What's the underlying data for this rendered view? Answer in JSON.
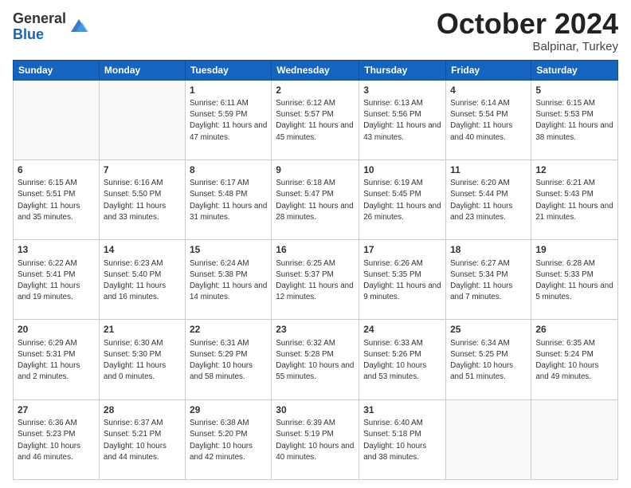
{
  "logo": {
    "general": "General",
    "blue": "Blue"
  },
  "title": {
    "month": "October 2024",
    "location": "Balpinar, Turkey"
  },
  "days_of_week": [
    "Sunday",
    "Monday",
    "Tuesday",
    "Wednesday",
    "Thursday",
    "Friday",
    "Saturday"
  ],
  "weeks": [
    [
      {
        "day": "",
        "info": ""
      },
      {
        "day": "",
        "info": ""
      },
      {
        "day": "1",
        "info": "Sunrise: 6:11 AM\nSunset: 5:59 PM\nDaylight: 11 hours and 47 minutes."
      },
      {
        "day": "2",
        "info": "Sunrise: 6:12 AM\nSunset: 5:57 PM\nDaylight: 11 hours and 45 minutes."
      },
      {
        "day": "3",
        "info": "Sunrise: 6:13 AM\nSunset: 5:56 PM\nDaylight: 11 hours and 43 minutes."
      },
      {
        "day": "4",
        "info": "Sunrise: 6:14 AM\nSunset: 5:54 PM\nDaylight: 11 hours and 40 minutes."
      },
      {
        "day": "5",
        "info": "Sunrise: 6:15 AM\nSunset: 5:53 PM\nDaylight: 11 hours and 38 minutes."
      }
    ],
    [
      {
        "day": "6",
        "info": "Sunrise: 6:15 AM\nSunset: 5:51 PM\nDaylight: 11 hours and 35 minutes."
      },
      {
        "day": "7",
        "info": "Sunrise: 6:16 AM\nSunset: 5:50 PM\nDaylight: 11 hours and 33 minutes."
      },
      {
        "day": "8",
        "info": "Sunrise: 6:17 AM\nSunset: 5:48 PM\nDaylight: 11 hours and 31 minutes."
      },
      {
        "day": "9",
        "info": "Sunrise: 6:18 AM\nSunset: 5:47 PM\nDaylight: 11 hours and 28 minutes."
      },
      {
        "day": "10",
        "info": "Sunrise: 6:19 AM\nSunset: 5:45 PM\nDaylight: 11 hours and 26 minutes."
      },
      {
        "day": "11",
        "info": "Sunrise: 6:20 AM\nSunset: 5:44 PM\nDaylight: 11 hours and 23 minutes."
      },
      {
        "day": "12",
        "info": "Sunrise: 6:21 AM\nSunset: 5:43 PM\nDaylight: 11 hours and 21 minutes."
      }
    ],
    [
      {
        "day": "13",
        "info": "Sunrise: 6:22 AM\nSunset: 5:41 PM\nDaylight: 11 hours and 19 minutes."
      },
      {
        "day": "14",
        "info": "Sunrise: 6:23 AM\nSunset: 5:40 PM\nDaylight: 11 hours and 16 minutes."
      },
      {
        "day": "15",
        "info": "Sunrise: 6:24 AM\nSunset: 5:38 PM\nDaylight: 11 hours and 14 minutes."
      },
      {
        "day": "16",
        "info": "Sunrise: 6:25 AM\nSunset: 5:37 PM\nDaylight: 11 hours and 12 minutes."
      },
      {
        "day": "17",
        "info": "Sunrise: 6:26 AM\nSunset: 5:35 PM\nDaylight: 11 hours and 9 minutes."
      },
      {
        "day": "18",
        "info": "Sunrise: 6:27 AM\nSunset: 5:34 PM\nDaylight: 11 hours and 7 minutes."
      },
      {
        "day": "19",
        "info": "Sunrise: 6:28 AM\nSunset: 5:33 PM\nDaylight: 11 hours and 5 minutes."
      }
    ],
    [
      {
        "day": "20",
        "info": "Sunrise: 6:29 AM\nSunset: 5:31 PM\nDaylight: 11 hours and 2 minutes."
      },
      {
        "day": "21",
        "info": "Sunrise: 6:30 AM\nSunset: 5:30 PM\nDaylight: 11 hours and 0 minutes."
      },
      {
        "day": "22",
        "info": "Sunrise: 6:31 AM\nSunset: 5:29 PM\nDaylight: 10 hours and 58 minutes."
      },
      {
        "day": "23",
        "info": "Sunrise: 6:32 AM\nSunset: 5:28 PM\nDaylight: 10 hours and 55 minutes."
      },
      {
        "day": "24",
        "info": "Sunrise: 6:33 AM\nSunset: 5:26 PM\nDaylight: 10 hours and 53 minutes."
      },
      {
        "day": "25",
        "info": "Sunrise: 6:34 AM\nSunset: 5:25 PM\nDaylight: 10 hours and 51 minutes."
      },
      {
        "day": "26",
        "info": "Sunrise: 6:35 AM\nSunset: 5:24 PM\nDaylight: 10 hours and 49 minutes."
      }
    ],
    [
      {
        "day": "27",
        "info": "Sunrise: 6:36 AM\nSunset: 5:23 PM\nDaylight: 10 hours and 46 minutes."
      },
      {
        "day": "28",
        "info": "Sunrise: 6:37 AM\nSunset: 5:21 PM\nDaylight: 10 hours and 44 minutes."
      },
      {
        "day": "29",
        "info": "Sunrise: 6:38 AM\nSunset: 5:20 PM\nDaylight: 10 hours and 42 minutes."
      },
      {
        "day": "30",
        "info": "Sunrise: 6:39 AM\nSunset: 5:19 PM\nDaylight: 10 hours and 40 minutes."
      },
      {
        "day": "31",
        "info": "Sunrise: 6:40 AM\nSunset: 5:18 PM\nDaylight: 10 hours and 38 minutes."
      },
      {
        "day": "",
        "info": ""
      },
      {
        "day": "",
        "info": ""
      }
    ]
  ]
}
